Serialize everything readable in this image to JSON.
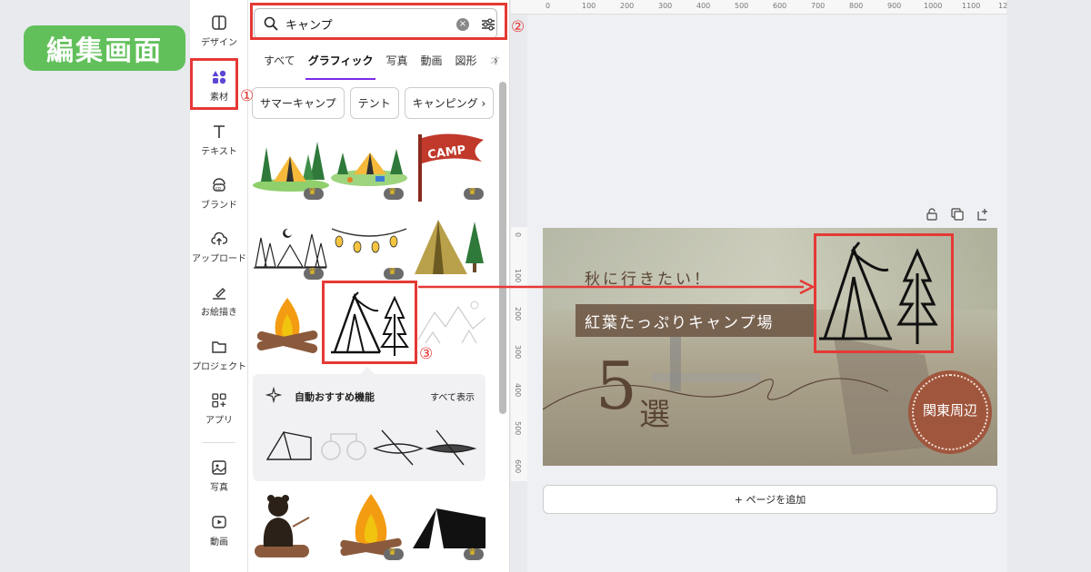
{
  "badge": "編集画面",
  "sidebar": {
    "items": [
      {
        "label": "デザイン",
        "icon": "design-icon"
      },
      {
        "label": "素材",
        "icon": "elements-icon"
      },
      {
        "label": "テキスト",
        "icon": "text-icon"
      },
      {
        "label": "ブランド",
        "icon": "brand-icon"
      },
      {
        "label": "アップロード",
        "icon": "upload-icon"
      },
      {
        "label": "お絵描き",
        "icon": "draw-icon"
      },
      {
        "label": "プロジェクト",
        "icon": "folder-icon"
      },
      {
        "label": "アプリ",
        "icon": "apps-icon"
      },
      {
        "label": "写真",
        "icon": "photo-icon"
      },
      {
        "label": "動画",
        "icon": "video-icon"
      }
    ]
  },
  "search": {
    "value": "キャンプ",
    "placeholder": ""
  },
  "tabs": [
    "すべて",
    "グラフィック",
    "写真",
    "動画",
    "図形",
    "オ"
  ],
  "chips": [
    "サマーキャンプ",
    "テント",
    "キャンピング"
  ],
  "graphic_flag_text": "CAMP",
  "auto_recommend": {
    "title": "自動おすすめ機能",
    "view_all": "すべて表示"
  },
  "ruler": {
    "top": [
      "0",
      "100",
      "200",
      "300",
      "400",
      "500",
      "600",
      "700",
      "800",
      "900",
      "1000",
      "1100",
      "12"
    ],
    "left": [
      "0",
      "100",
      "200",
      "300",
      "400",
      "500",
      "600"
    ]
  },
  "design": {
    "line1": "秋に行きたい！",
    "line2": "紅葉たっぷりキャンプ場",
    "number": "5",
    "number_suffix": "選",
    "circle_text": "関東周辺"
  },
  "add_page": "+ ページを追加",
  "callouts": [
    "①",
    "②",
    "③"
  ],
  "colors": {
    "highlight": "#e53935",
    "badge": "#62c05a",
    "accent": "#7d2ae8"
  }
}
